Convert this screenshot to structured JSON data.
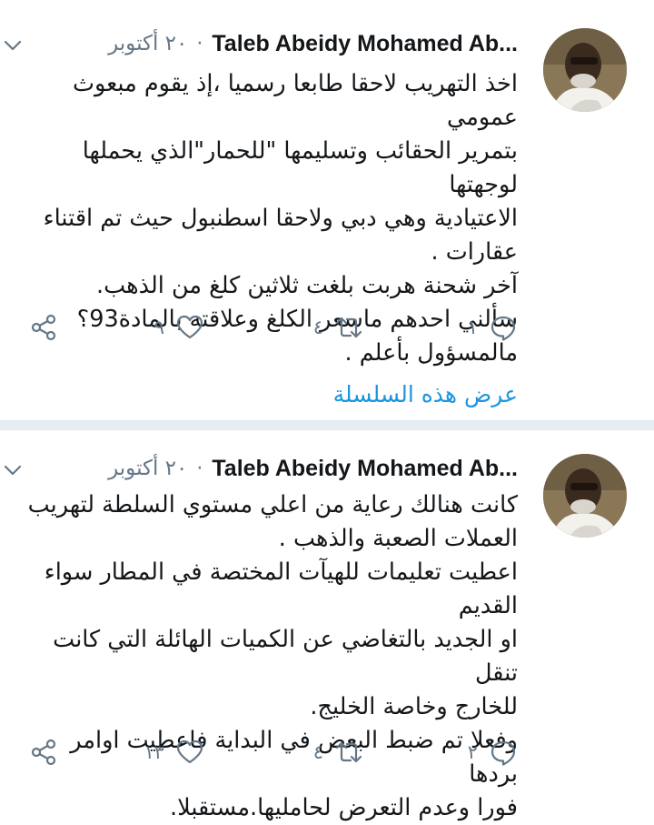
{
  "tweets": [
    {
      "author": "Taleb Abeidy Mohamed Ab...",
      "dot": "·",
      "date": "٢٠ أكتوبر",
      "lines": [
        "اخذ التهريب لاحقا طابعا رسميا ،إذ يقوم مبعوث عمومي",
        "بتمرير الحقائب وتسليمها \"للحمار\"الذي يحملها لوجهتها",
        "الاعتيادية وهي دبي ولاحقا اسطنبول حيث تم اقتناء",
        "عقارات .",
        "آخر شحنة هربت بلغت ثلاثين كلغ من الذهب.",
        "سألني احدهم ماسعر الكلغ وعلاقته بالمادة93؟",
        "مالمسؤول بأعلم ."
      ],
      "replies": "١",
      "retweets": "٤",
      "likes": "٩",
      "show_thread": "عرض هذه السلسلة"
    },
    {
      "author": "Taleb Abeidy Mohamed Ab...",
      "dot": "·",
      "date": "٢٠ أكتوبر",
      "lines": [
        "كانت هنالك رعاية  من اعلي مستوي السلطة لتهريب",
        "العملات الصعبة والذهب .",
        "اعطيت تعليمات للهيآت المختصة في المطار سواء القديم",
        "او الجديد بالتغاضي عن الكميات الهائلة التي كانت تنقل",
        "للخارج وخاصة الخليج.",
        "وفعلا تم ضبط البعض  في البداية فاعطيت اوامر بردها",
        "فورا وعدم التعرض لحامليها.مستقبلا."
      ],
      "replies": "٢",
      "retweets": "٤",
      "likes": "١٣"
    }
  ],
  "colors": {
    "text": "#14171a",
    "muted": "#657786",
    "link": "#1b95e0",
    "divider": "#e1e8ed"
  },
  "icons": [
    "chevron-down-icon",
    "reply-icon",
    "retweet-icon",
    "like-icon",
    "share-icon"
  ]
}
